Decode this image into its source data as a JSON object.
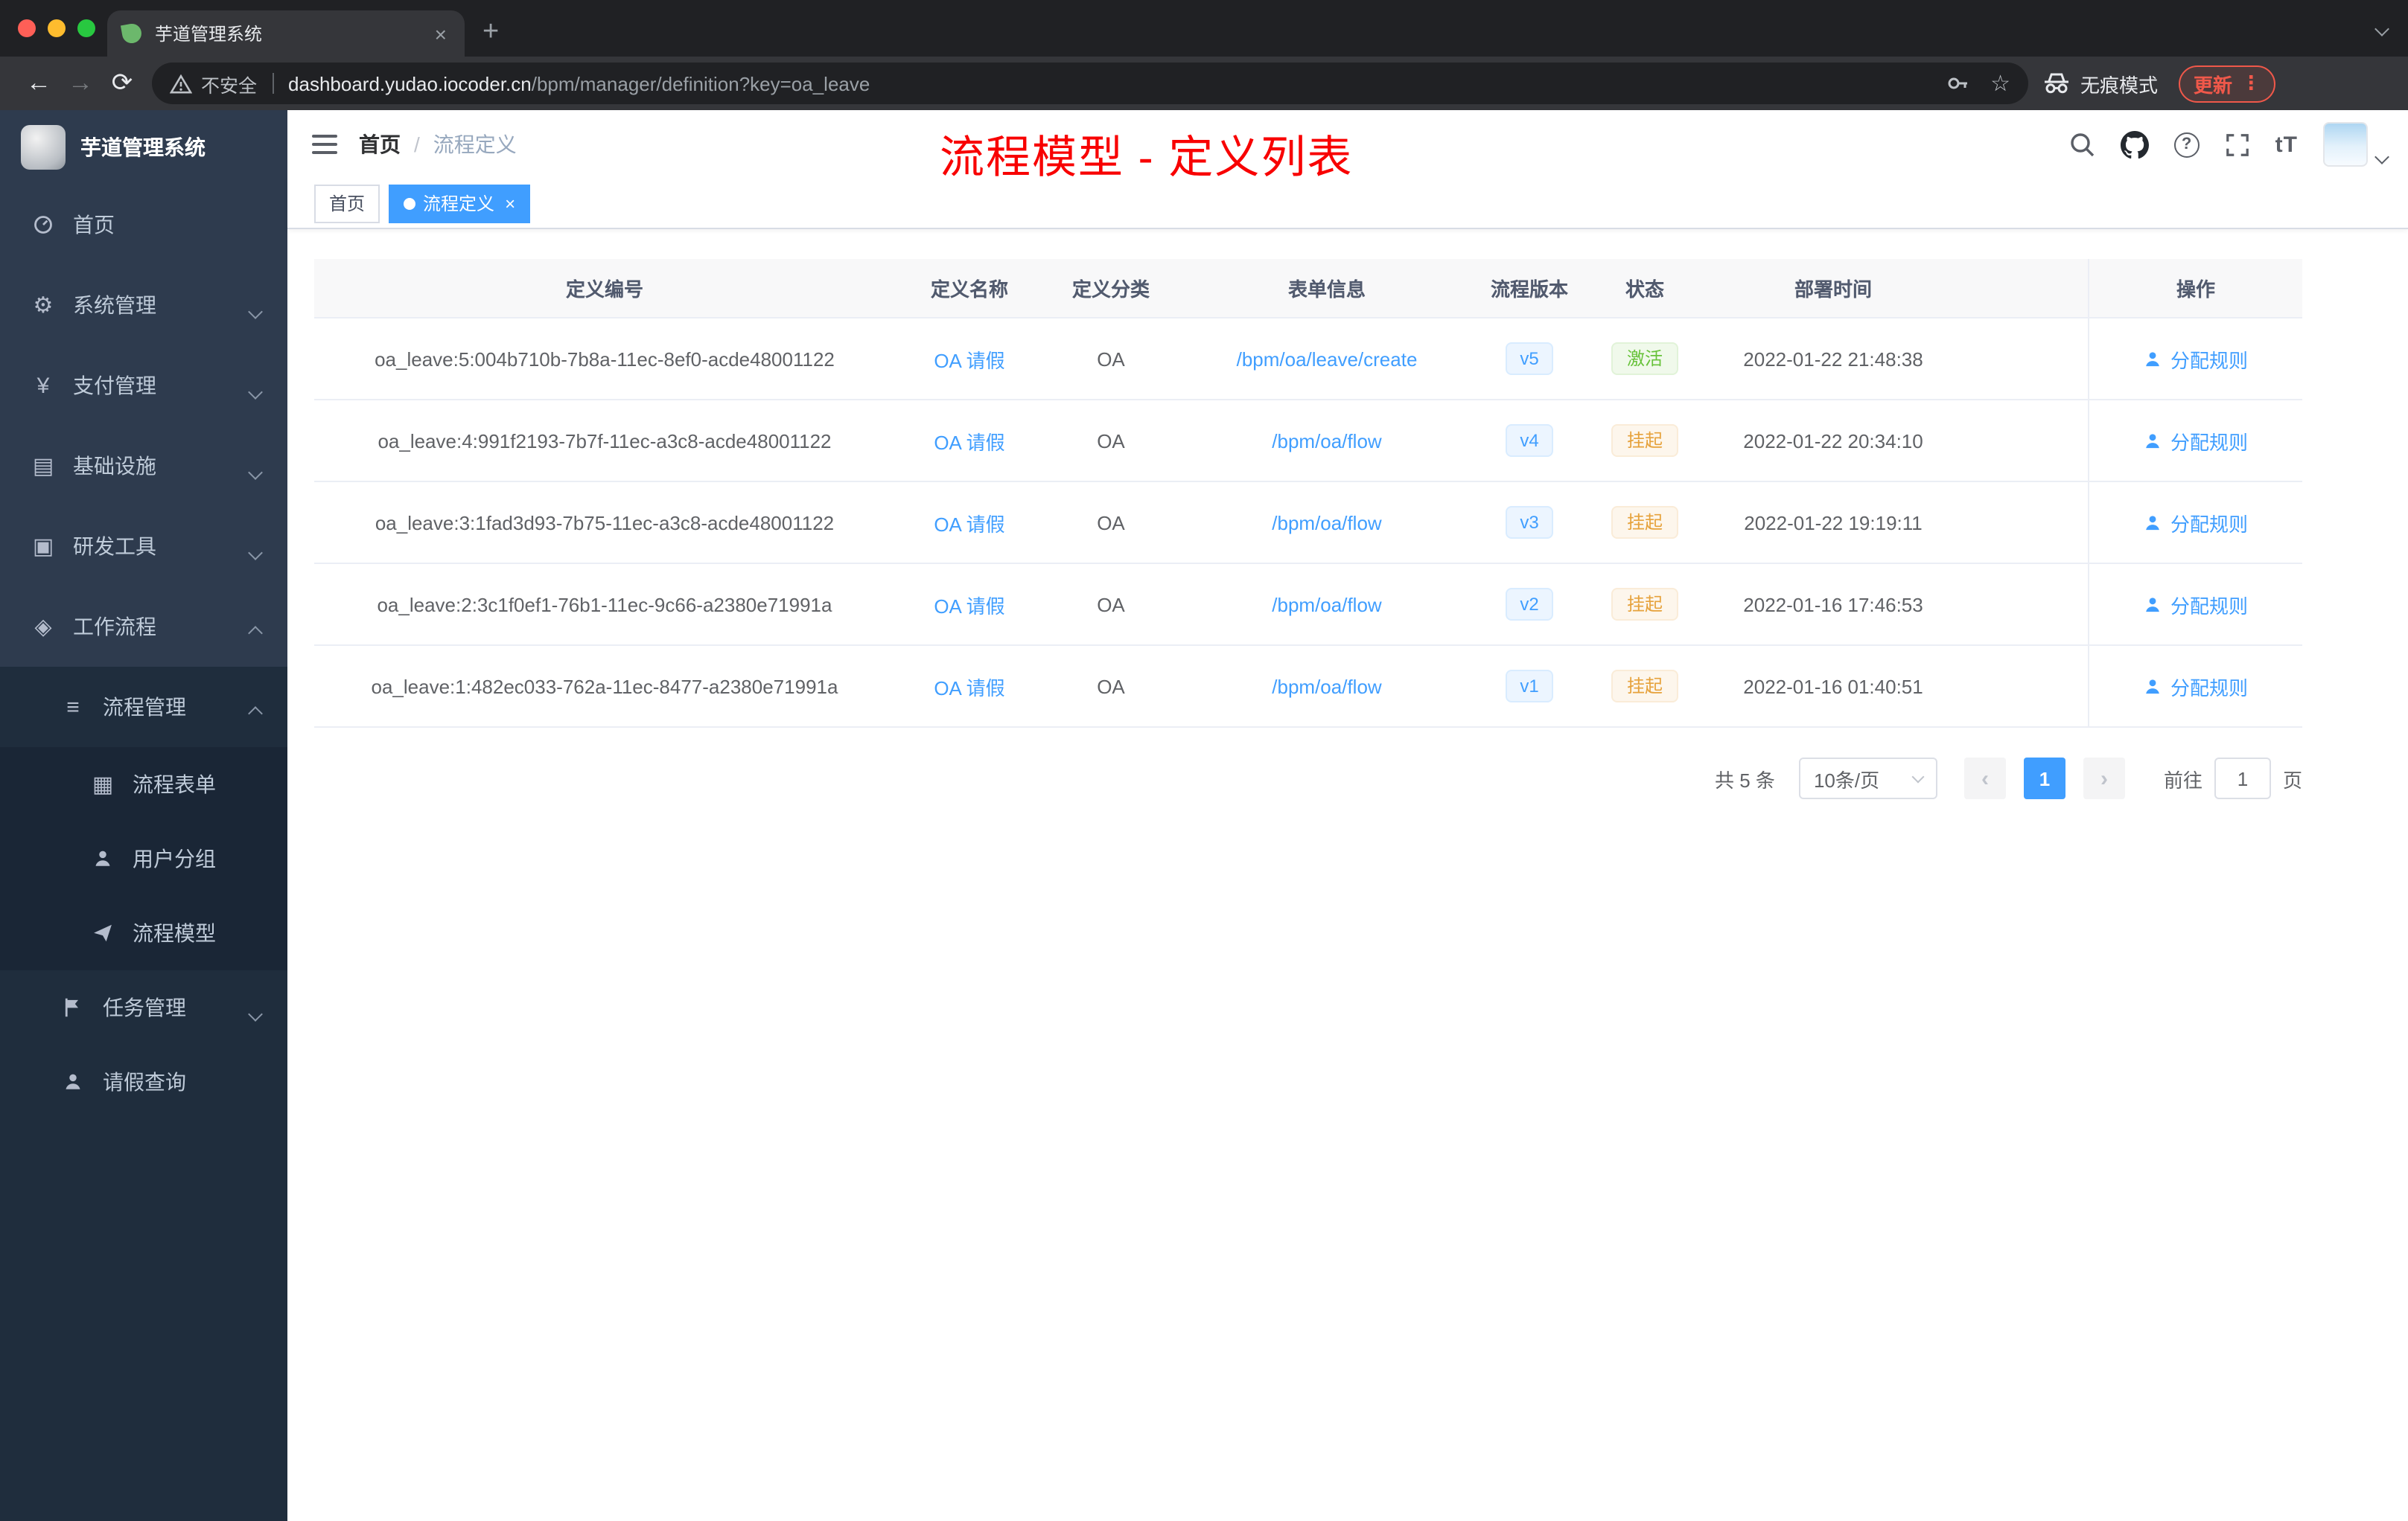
{
  "colors": {
    "accent": "#409eff",
    "success": "#67c23a",
    "warning": "#e6a23c",
    "annotation": "#ff0000"
  },
  "browser": {
    "tab": {
      "title": "芋道管理系统",
      "close": "×"
    },
    "new_tab_label": "+",
    "nav": {
      "back": "←",
      "forward": "→",
      "reload": "⟳"
    },
    "security_label": "不安全",
    "url": {
      "domain": "dashboard.yudao.iocoder.cn",
      "path": "/bpm/manager/definition?key=oa_leave"
    },
    "incognito_label": "无痕模式",
    "update_label": "更新",
    "menu_glyph": "⋮"
  },
  "sidebar": {
    "logo_title": "芋道管理系统",
    "items": [
      {
        "label": "首页"
      },
      {
        "label": "系统管理"
      },
      {
        "label": "支付管理"
      },
      {
        "label": "基础设施"
      },
      {
        "label": "研发工具"
      },
      {
        "label": "工作流程"
      },
      {
        "label": "流程管理"
      },
      {
        "label": "流程表单"
      },
      {
        "label": "用户分组"
      },
      {
        "label": "流程模型"
      },
      {
        "label": "任务管理"
      },
      {
        "label": "请假查询"
      }
    ]
  },
  "header": {
    "breadcrumb": {
      "home": "首页",
      "separator": "/",
      "current": "流程定义"
    },
    "annotation": "流程模型 - 定义列表",
    "font_icon_label": "tT"
  },
  "tags": [
    {
      "label": "首页"
    },
    {
      "label": "流程定义",
      "close": "×"
    }
  ],
  "table": {
    "columns": [
      "定义编号",
      "定义名称",
      "定义分类",
      "表单信息",
      "流程版本",
      "状态",
      "部署时间",
      "操作"
    ],
    "rows": [
      {
        "id": "oa_leave:5:004b710b-7b8a-11ec-8ef0-acde48001122",
        "name": "OA 请假",
        "category": "OA",
        "form": "/bpm/oa/leave/create",
        "version": "v5",
        "status": "激活",
        "time": "2022-01-22 21:48:38",
        "action": "分配规则"
      },
      {
        "id": "oa_leave:4:991f2193-7b7f-11ec-a3c8-acde48001122",
        "name": "OA 请假",
        "category": "OA",
        "form": "/bpm/oa/flow",
        "version": "v4",
        "status": "挂起",
        "time": "2022-01-22 20:34:10",
        "action": "分配规则"
      },
      {
        "id": "oa_leave:3:1fad3d93-7b75-11ec-a3c8-acde48001122",
        "name": "OA 请假",
        "category": "OA",
        "form": "/bpm/oa/flow",
        "version": "v3",
        "status": "挂起",
        "time": "2022-01-22 19:19:11",
        "action": "分配规则"
      },
      {
        "id": "oa_leave:2:3c1f0ef1-76b1-11ec-9c66-a2380e71991a",
        "name": "OA 请假",
        "category": "OA",
        "form": "/bpm/oa/flow",
        "version": "v2",
        "status": "挂起",
        "time": "2022-01-16 17:46:53",
        "action": "分配规则"
      },
      {
        "id": "oa_leave:1:482ec033-762a-11ec-8477-a2380e71991a",
        "name": "OA 请假",
        "category": "OA",
        "form": "/bpm/oa/flow",
        "version": "v1",
        "status": "挂起",
        "time": "2022-01-16 01:40:51",
        "action": "分配规则"
      }
    ]
  },
  "pagination": {
    "total": "共 5 条",
    "page_size": "10条/页",
    "prev": "‹",
    "current": "1",
    "next": "›",
    "goto_label": "前往",
    "goto_value": "1",
    "goto_unit": "页"
  }
}
